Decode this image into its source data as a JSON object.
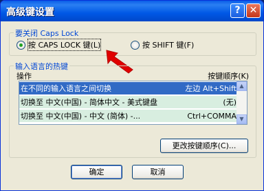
{
  "window": {
    "title": "高级键设置"
  },
  "titlebar": {
    "help_glyph": "?",
    "close_glyph": "✕"
  },
  "caps_lock_group": {
    "legend": "要关闭 Caps Lock",
    "options": [
      {
        "label": "按 CAPS LOCK 键(L)",
        "selected": true
      },
      {
        "label": "按 SHIFT 键(F)",
        "selected": false
      }
    ]
  },
  "hotkeys_group": {
    "legend": "输入语言的热键",
    "col_action": "操作",
    "col_keys": "按键顺序(K)",
    "rows": [
      {
        "action": "在不同的输入语言之间切换",
        "keys": "左边 Alt+Shift",
        "selected": true
      },
      {
        "action": "切换至 中文(中国) - 简体中文 - 美式键盘",
        "keys": "(无)",
        "selected": false
      },
      {
        "action": "切换至 中文(中国) - 中文 (简体) -...",
        "keys": "Ctrl+COMMA",
        "selected": false
      }
    ],
    "change_button": "更改按键顺序(C)..."
  },
  "footer": {
    "ok": "确定",
    "cancel": "取消"
  },
  "icons": {
    "pointer": "red-arrow-icon"
  },
  "colors": {
    "title_blue": "#0058e6",
    "selection": "#316ac5",
    "group_legend": "#0046d5",
    "arrow_red": "#e00000"
  }
}
